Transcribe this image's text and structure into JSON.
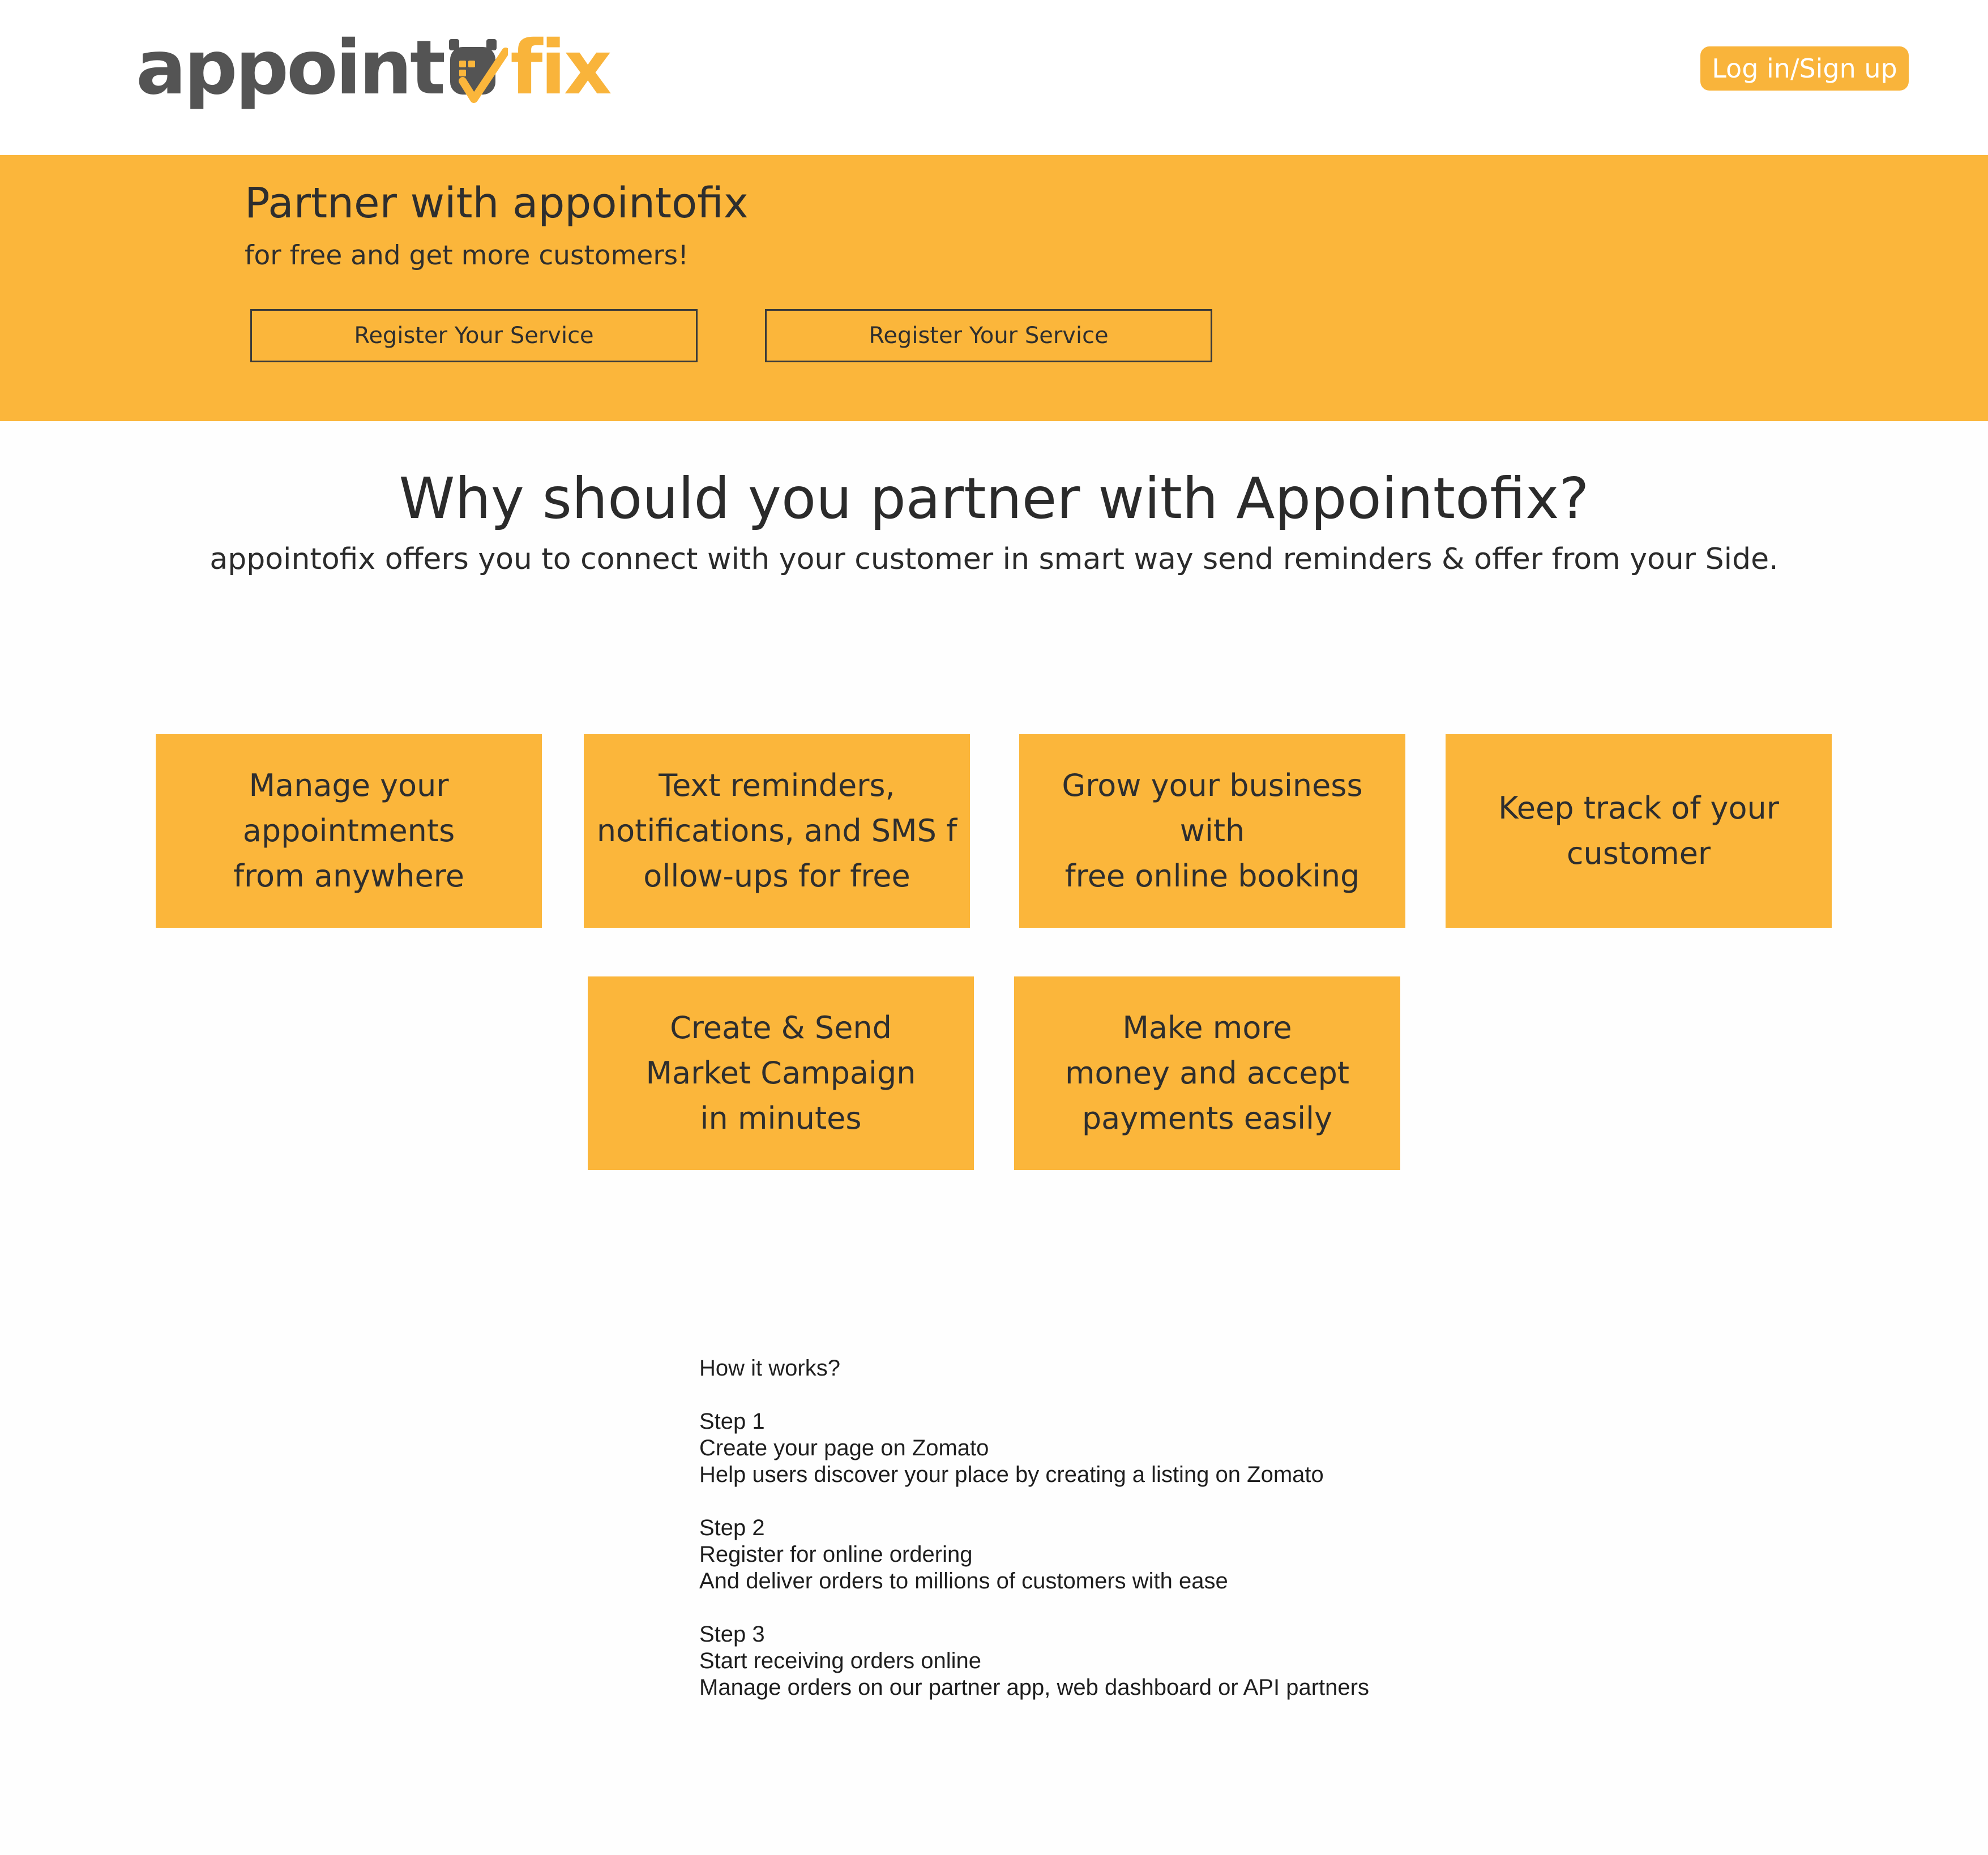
{
  "header": {
    "logo_dark": "appoint",
    "logo_accent": "fix",
    "login_label": "Log in/Sign up"
  },
  "hero": {
    "title": "Partner with appointofix",
    "subtitle": "for free and get more customers!",
    "buttons": [
      {
        "label": "Register Your Service"
      },
      {
        "label": "Register Your Service"
      }
    ]
  },
  "why": {
    "title": "Why should you partner with Appointofix?",
    "subtitle": "appointofix offers you to connect with your customer in smart way send reminders & offer from your Side."
  },
  "features": [
    {
      "text": "Manage your\nappointments\nfrom anywhere"
    },
    {
      "text": "Text reminders,\nnotifications, and SMS f\nollow-ups for free"
    },
    {
      "text": "Grow your business with\nfree online booking"
    },
    {
      "text": "Keep track of your\ncustomer"
    },
    {
      "text": "Create & Send\nMarket Campaign\nin minutes"
    },
    {
      "text": "Make more\nmoney and accept\npayments easily"
    }
  ],
  "how_it_works": {
    "title": "How it works?",
    "steps": [
      {
        "label": "Step 1",
        "heading": "Create your page on Zomato",
        "description": "Help users discover your place by creating a listing on Zomato"
      },
      {
        "label": "Step 2",
        "heading": "Register for online ordering",
        "description": "And deliver orders to millions of customers with ease"
      },
      {
        "label": "Step 3",
        "heading": "Start receiving orders online",
        "description": "Manage orders on our partner app, web dashboard or API partners"
      }
    ]
  },
  "colors": {
    "accent": "#fbb63b",
    "logo_dark": "#545454",
    "text": "#2b2b2b"
  }
}
